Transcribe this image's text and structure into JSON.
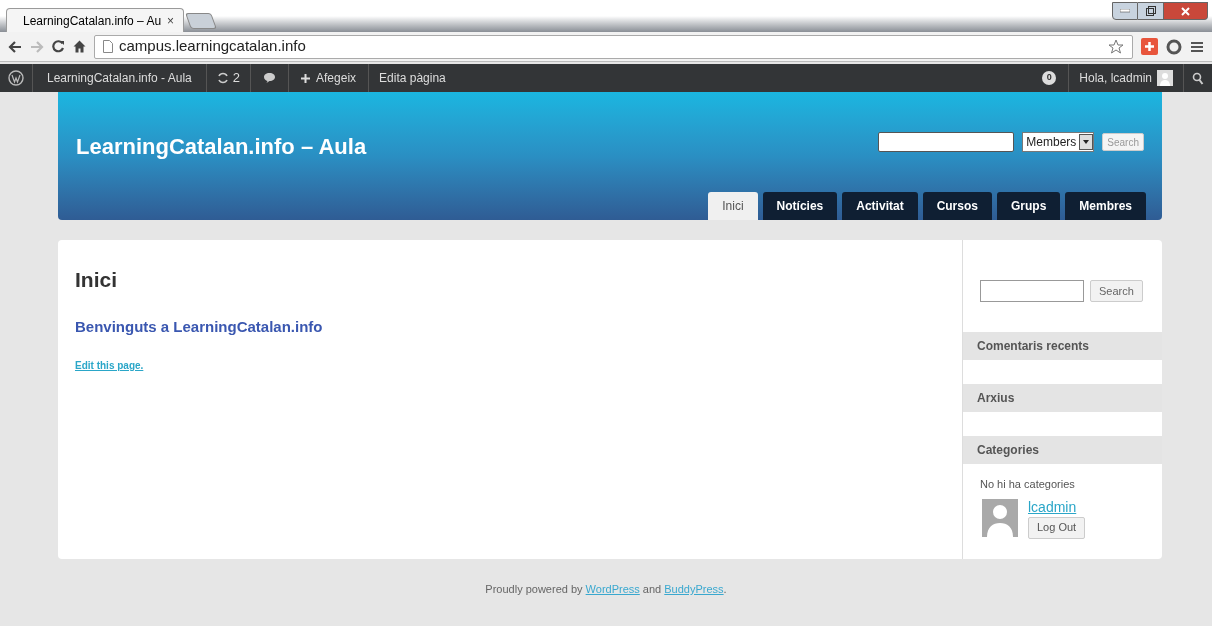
{
  "browser": {
    "tab_title": "LearningCatalan.info – Au",
    "tab_close": "×",
    "url": "campus.learningcatalan.info"
  },
  "admin_bar": {
    "site": "LearningCatalan.info - Aula",
    "updates": "2",
    "new": "Afegeix",
    "edit": "Edita pàgina",
    "notifications": "0",
    "greeting": "Hola, lcadmin"
  },
  "header": {
    "site_title": "LearningCatalan.info – Aula",
    "search_scope": "Members",
    "search_button": "Search"
  },
  "nav": [
    {
      "label": "Inici",
      "selected": true
    },
    {
      "label": "Notícies",
      "selected": false
    },
    {
      "label": "Activitat",
      "selected": false
    },
    {
      "label": "Cursos",
      "selected": false
    },
    {
      "label": "Grups",
      "selected": false
    },
    {
      "label": "Membres",
      "selected": false
    }
  ],
  "content": {
    "title": "Inici",
    "heading": "Benvinguts a LearningCatalan.info",
    "edit_link": "Edit this page."
  },
  "sidebar": {
    "search_button": "Search",
    "widgets": [
      {
        "title": "Comentaris recents"
      },
      {
        "title": "Arxius"
      },
      {
        "title": "Categories",
        "text": "No hi ha categories"
      }
    ],
    "user": "lcadmin",
    "logout": "Log Out"
  },
  "footer": [
    {
      "kind": "text",
      "text": "Proudly powered by"
    },
    {
      "kind": "link",
      "text": "WordPress"
    },
    {
      "kind": "text",
      "text": "and"
    },
    {
      "kind": "link",
      "text": "BuddyPress"
    },
    {
      "kind": "text",
      "text": "."
    }
  ]
}
